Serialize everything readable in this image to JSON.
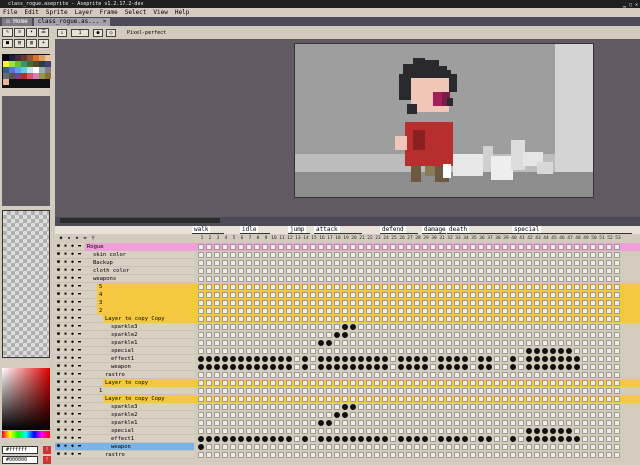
{
  "window": {
    "title": "class_rogue.aseprite - Aseprite v1.2.17.2-dev",
    "controls": "▁ ▢ ✕"
  },
  "menu": [
    "File",
    "Edit",
    "Sprite",
    "Layer",
    "Frame",
    "Select",
    "View",
    "Help"
  ],
  "tabs": [
    {
      "label": "Home",
      "active": false
    },
    {
      "label": "class_rogue.as... ×",
      "active": true
    }
  ],
  "toolbar": {
    "frame_value": "1",
    "pixel_perfect_label": "Pixel-perfect"
  },
  "palette": {
    "colors": [
      "#000000",
      "#222034",
      "#45283c",
      "#663931",
      "#8f563b",
      "#df7126",
      "#d9a066",
      "#eec39a",
      "#fbf236",
      "#99e550",
      "#6abe30",
      "#37946e",
      "#4b692f",
      "#524b24",
      "#323c39",
      "#3f3f74",
      "#306082",
      "#5b6ee1",
      "#639bff",
      "#5fcde4",
      "#cbdbfc",
      "#ffffff",
      "#9badb7",
      "#847e87",
      "#696a6a",
      "#595652",
      "#76428a",
      "#ac3232",
      "#d95763",
      "#d77bba",
      "#8f974a",
      "#8a6f30",
      "#e8b796"
    ],
    "fg_hex": "#ffffff",
    "bg_hex": "#000000"
  },
  "tags": [
    {
      "name": "walk"
    },
    {
      "name": "idle"
    },
    {
      "name": "jump"
    },
    {
      "name": "attack"
    },
    {
      "name": "defend"
    },
    {
      "name": "damage"
    },
    {
      "name": "death"
    },
    {
      "name": "special"
    }
  ],
  "frames": [
    "1",
    "2",
    "3",
    "4",
    "5",
    "6",
    "7",
    "8",
    "9",
    "10",
    "11",
    "12",
    "13",
    "14",
    "15",
    "16",
    "17",
    "18",
    "19",
    "20",
    "21",
    "22",
    "23",
    "24",
    "25",
    "26",
    "27",
    "28",
    "29",
    "30",
    "31",
    "32",
    "33",
    "34",
    "35",
    "36",
    "37",
    "38",
    "39",
    "40",
    "41",
    "42",
    "43",
    "44",
    "45",
    "46",
    "47",
    "48",
    "49",
    "50",
    "51",
    "52",
    "53"
  ],
  "layers": [
    {
      "name": "Rogue",
      "indent": 0,
      "kind": "hi",
      "cells": []
    },
    {
      "name": "skin color",
      "indent": 1,
      "kind": "",
      "cells": []
    },
    {
      "name": "Backup",
      "indent": 1,
      "kind": "",
      "cells": []
    },
    {
      "name": "cloth color",
      "indent": 1,
      "kind": "",
      "cells": []
    },
    {
      "name": "weapons",
      "indent": 1,
      "kind": "",
      "cells": []
    },
    {
      "name": "5",
      "indent": 2,
      "kind": "grp",
      "cells": []
    },
    {
      "name": "4",
      "indent": 2,
      "kind": "grp",
      "cells": []
    },
    {
      "name": "3",
      "indent": 2,
      "kind": "grp",
      "cells": []
    },
    {
      "name": "2",
      "indent": 2,
      "kind": "grp",
      "cells": []
    },
    {
      "name": "Layer to copy Copy",
      "indent": 3,
      "kind": "grp",
      "cells": []
    },
    {
      "name": "sparkle3",
      "indent": 4,
      "kind": "",
      "cells": [
        19,
        20
      ]
    },
    {
      "name": "sparkle2",
      "indent": 4,
      "kind": "",
      "cells": [
        18,
        19
      ]
    },
    {
      "name": "sparkle1",
      "indent": 4,
      "kind": "",
      "cells": [
        16,
        17
      ]
    },
    {
      "name": "special",
      "indent": 4,
      "kind": "",
      "cells": [
        42,
        43,
        44,
        45,
        46,
        47
      ]
    },
    {
      "name": "effect1",
      "indent": 4,
      "kind": "",
      "cells": [
        1,
        2,
        3,
        4,
        5,
        6,
        7,
        8,
        9,
        10,
        11,
        12,
        14,
        16,
        17,
        18,
        19,
        20,
        21,
        22,
        23,
        24,
        26,
        27,
        28,
        29,
        31,
        32,
        33,
        34,
        36,
        37,
        40,
        42,
        43,
        44,
        45,
        46,
        47,
        48
      ]
    },
    {
      "name": "weapon",
      "indent": 4,
      "kind": "",
      "cells": [
        1,
        2,
        3,
        4,
        5,
        6,
        7,
        8,
        9,
        10,
        11,
        12,
        14,
        16,
        17,
        18,
        19,
        20,
        21,
        22,
        23,
        24,
        26,
        27,
        28,
        29,
        31,
        32,
        33,
        34,
        36,
        37,
        40,
        42,
        43,
        44,
        45,
        46,
        47,
        48
      ]
    },
    {
      "name": "rastro",
      "indent": 3,
      "kind": "",
      "cells": []
    },
    {
      "name": "Layer to copy",
      "indent": 3,
      "kind": "grp",
      "cells": []
    },
    {
      "name": "1",
      "indent": 2,
      "kind": "",
      "cells": []
    },
    {
      "name": "Layer to copy Copy",
      "indent": 3,
      "kind": "grp",
      "cells": []
    },
    {
      "name": "sparkle3",
      "indent": 4,
      "kind": "",
      "cells": [
        19,
        20
      ]
    },
    {
      "name": "sparkle2",
      "indent": 4,
      "kind": "",
      "cells": [
        18,
        19
      ]
    },
    {
      "name": "sparkle1",
      "indent": 4,
      "kind": "",
      "cells": [
        16,
        17
      ]
    },
    {
      "name": "special",
      "indent": 4,
      "kind": "",
      "cells": [
        42,
        43,
        44,
        45,
        46,
        47
      ]
    },
    {
      "name": "effect1",
      "indent": 4,
      "kind": "",
      "cells": [
        1,
        2,
        3,
        4,
        5,
        6,
        7,
        8,
        9,
        10,
        11,
        12,
        14,
        16,
        17,
        18,
        19,
        20,
        21,
        22,
        23,
        24,
        26,
        27,
        28,
        29,
        31,
        32,
        33,
        34,
        36,
        37,
        40,
        42,
        43,
        44,
        45,
        46,
        47,
        48
      ]
    },
    {
      "name": "weapon",
      "indent": 4,
      "kind": "sel",
      "cells": [
        1
      ]
    },
    {
      "name": "rastro",
      "indent": 3,
      "kind": "",
      "cells": []
    }
  ],
  "colors": {
    "panel": "#d3cbbe",
    "workspace": "#625a63",
    "group_highlight": "#f5c842",
    "root_highlight": "#f0a0d8",
    "selection": "#7bb4e8"
  },
  "icons": [
    "eye-icon",
    "lock-icon",
    "continuous-icon",
    "folder-icon",
    "cel-icon",
    "play-icon",
    "onion-skin-icon"
  ]
}
